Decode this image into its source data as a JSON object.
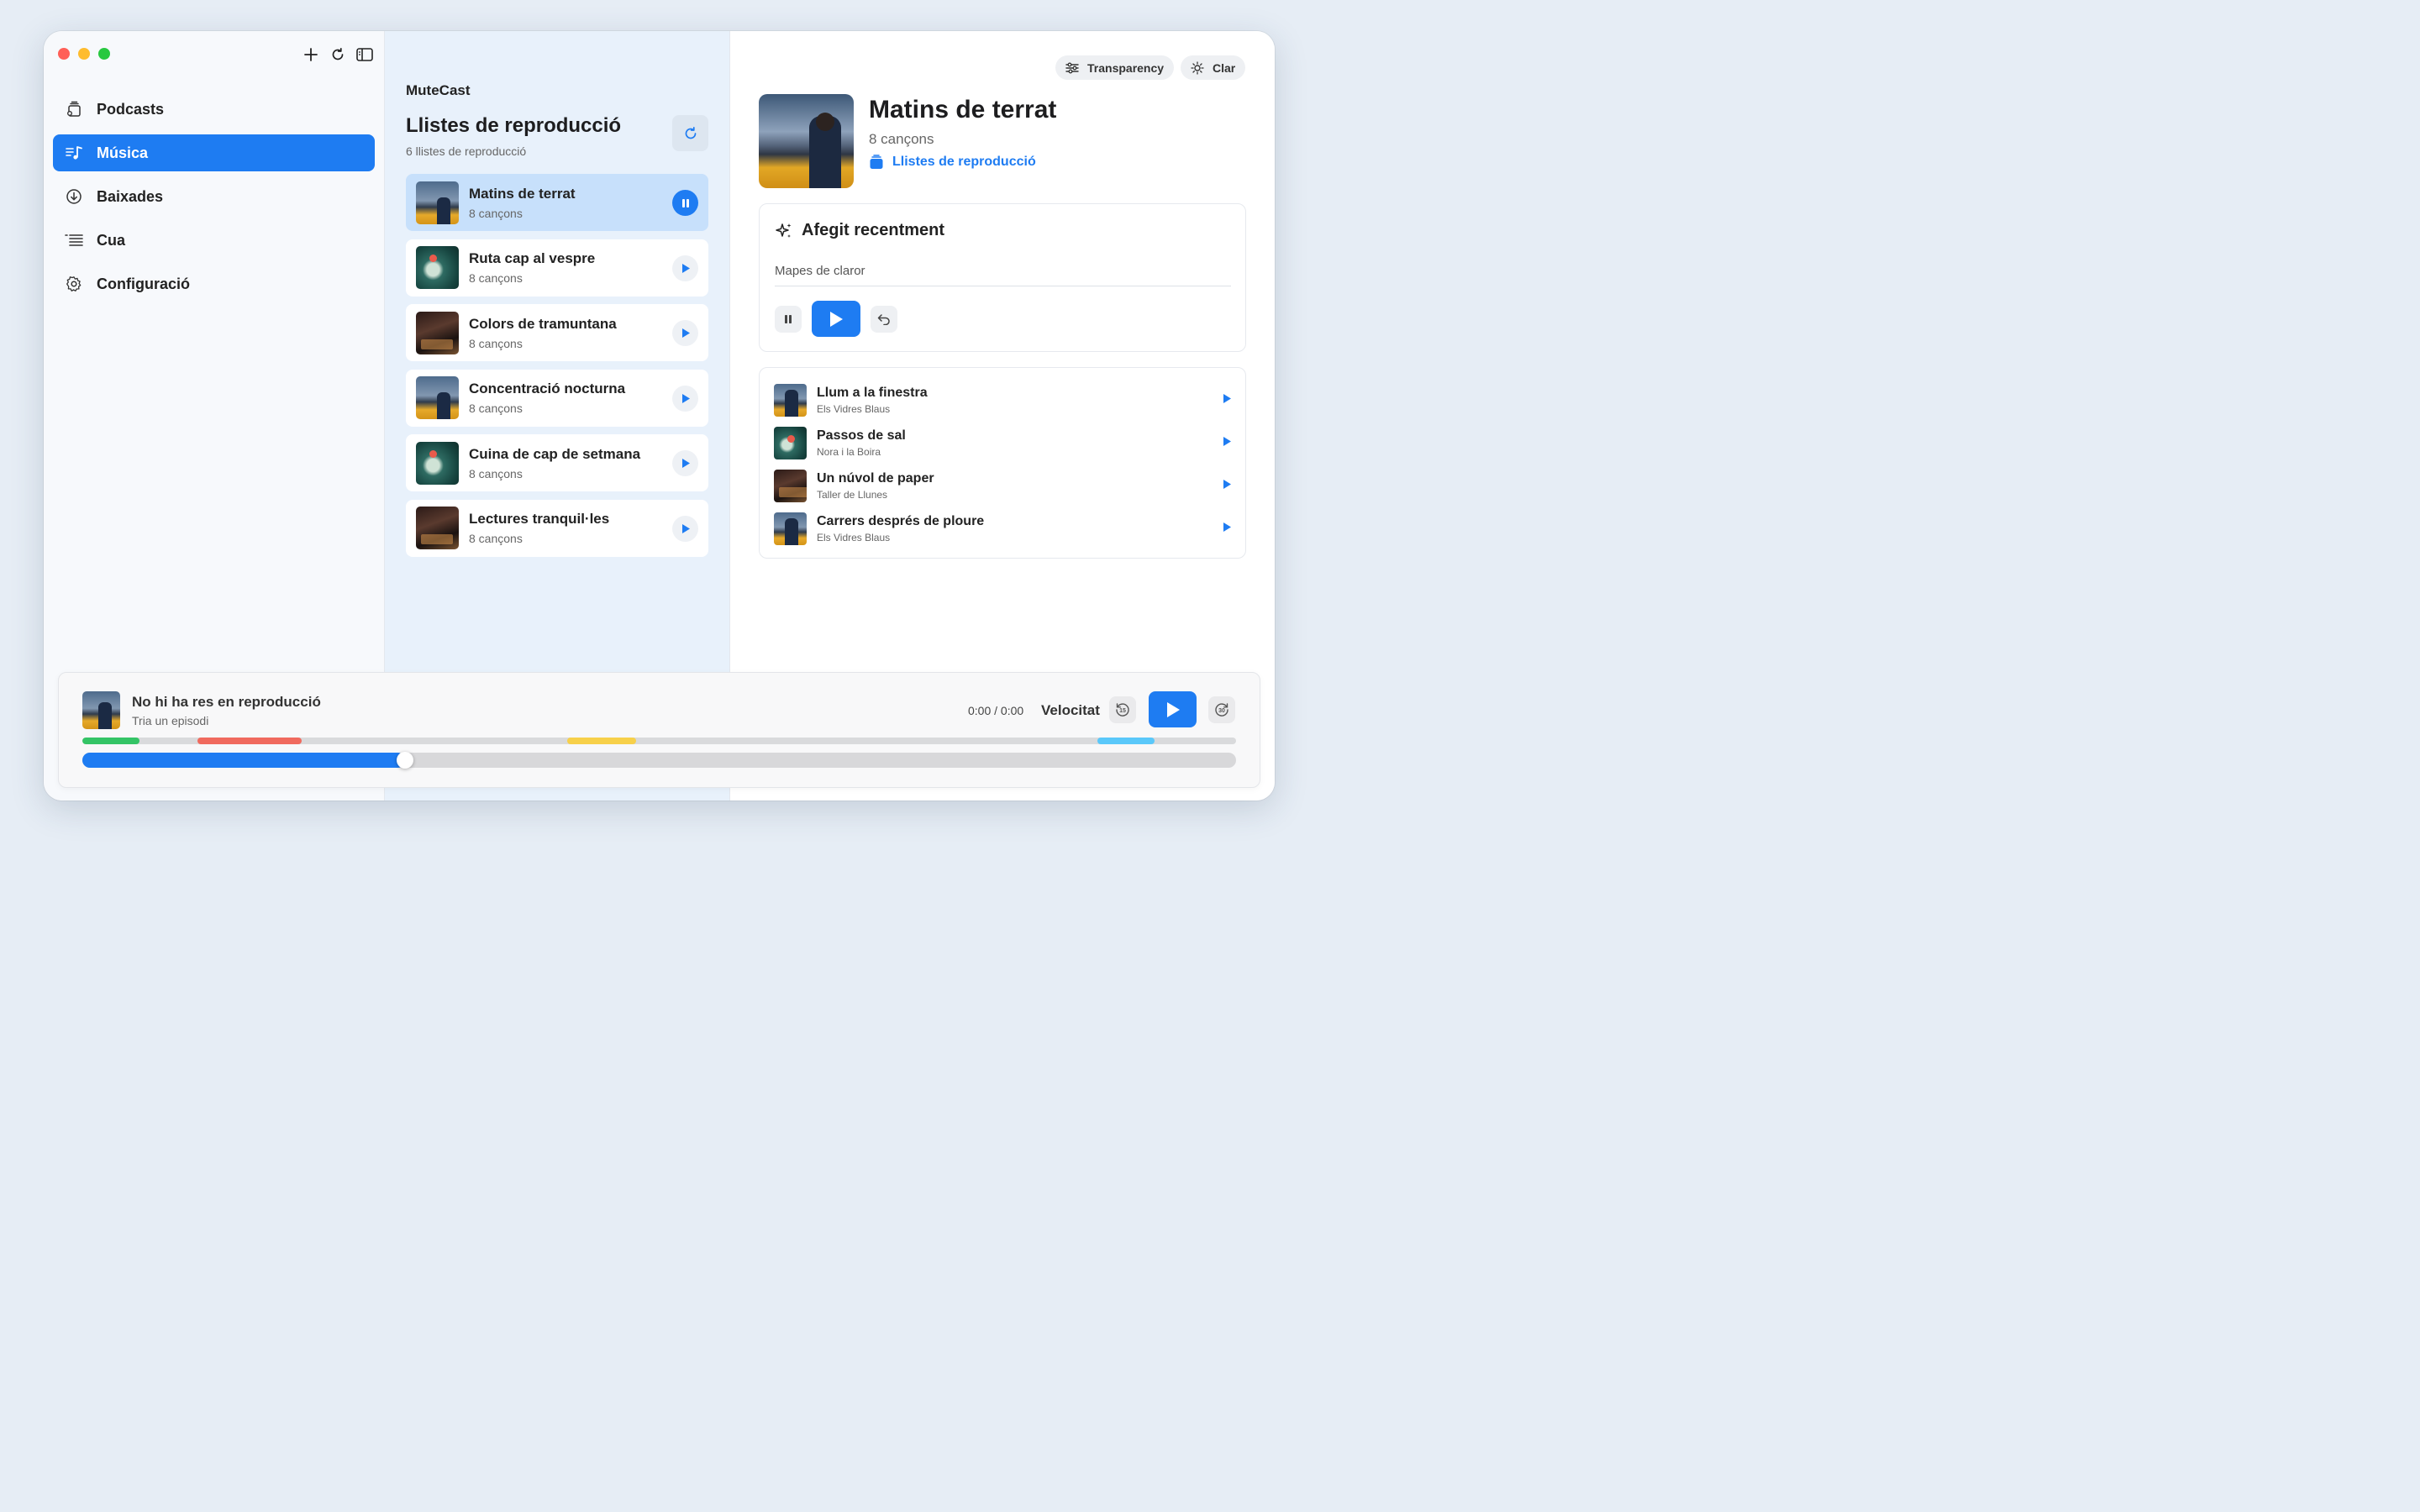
{
  "sidebar": {
    "items": [
      {
        "label": "Podcasts",
        "icon": "podcasts-icon",
        "active": false
      },
      {
        "label": "Música",
        "icon": "music-icon",
        "active": true
      },
      {
        "label": "Baixades",
        "icon": "download-icon",
        "active": false
      },
      {
        "label": "Cua",
        "icon": "queue-icon",
        "active": false
      },
      {
        "label": "Configuració",
        "icon": "gear-icon",
        "active": false
      }
    ]
  },
  "list": {
    "app_name": "MuteCast",
    "title": "Llistes de reproducció",
    "count": "6 llistes de reproducció",
    "playlists": [
      {
        "name": "Matins de terrat",
        "sub": "8 cançons",
        "state": "playing"
      },
      {
        "name": "Ruta cap al vespre",
        "sub": "8 cançons",
        "state": "paused"
      },
      {
        "name": "Colors de tramuntana",
        "sub": "8 cançons",
        "state": "paused"
      },
      {
        "name": "Concentració nocturna",
        "sub": "8 cançons",
        "state": "paused"
      },
      {
        "name": "Cuina de cap de setmana",
        "sub": "8 cançons",
        "state": "paused"
      },
      {
        "name": "Lectures tranquil·les",
        "sub": "8 cançons",
        "state": "paused"
      }
    ]
  },
  "detail": {
    "transparency_label": "Transparency",
    "theme_label": "Clar",
    "title": "Matins de terrat",
    "sub": "8 cançons",
    "link": "Llistes de reproducció",
    "recent": {
      "heading": "Afegit recentment",
      "value": "Mapes de claror"
    },
    "tracks": [
      {
        "name": "Llum a la finestra",
        "artist": "Els Vidres Blaus"
      },
      {
        "name": "Passos de sal",
        "artist": "Nora i la Boira"
      },
      {
        "name": "Un núvol de paper",
        "artist": "Taller de Llunes"
      },
      {
        "name": "Carrers després de ploure",
        "artist": "Els Vidres Blaus"
      }
    ]
  },
  "player": {
    "title": "No hi ha res en reproducció",
    "sub": "Tria un episodi",
    "time": "0:00 / 0:00",
    "speed_label": "Velocitat",
    "skip_back": "15",
    "skip_forward": "30",
    "progress": 0.28,
    "chapter_colors": [
      "#34c466",
      "#f06a5e",
      "#f7d04a",
      "#5ac8fa"
    ]
  },
  "colors": {
    "accent": "#1e7cf2"
  }
}
